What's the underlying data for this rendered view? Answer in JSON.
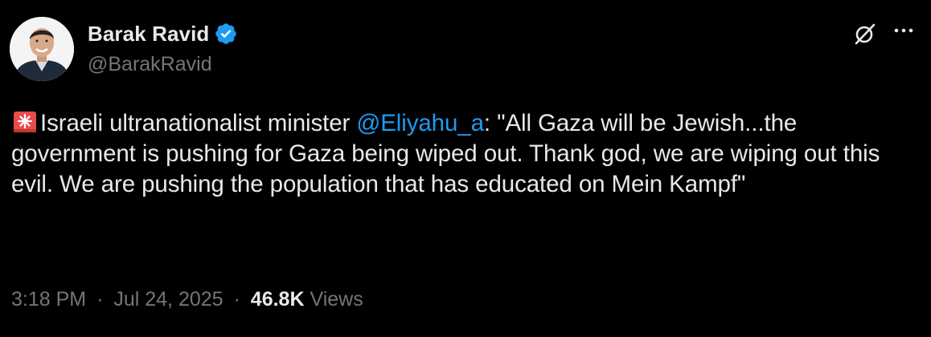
{
  "author": {
    "display_name": "Barak Ravid",
    "handle": "@BarakRavid",
    "verified": true
  },
  "icons": {
    "verified": "verified-badge-icon",
    "grok": "grok-icon",
    "more": "more-options-icon",
    "siren": "rotating-light-emoji-icon"
  },
  "tweet": {
    "text_part1": "Israeli ultranationalist minister ",
    "mention": "@Eliyahu_a",
    "text_part2": ": \"All Gaza will be Jewish...the government is pushing for Gaza being wiped out. Thank god, we are wiping out this evil. We are pushing the population that has educated on Mein Kampf\""
  },
  "meta": {
    "time": "3:18 PM",
    "date": "Jul 24, 2025",
    "separator": "·",
    "views_count": "46.8K",
    "views_label": "Views"
  },
  "colors": {
    "background": "#000000",
    "text": "#e7e9ea",
    "secondary": "#71767b",
    "accent": "#1d9bf0"
  }
}
